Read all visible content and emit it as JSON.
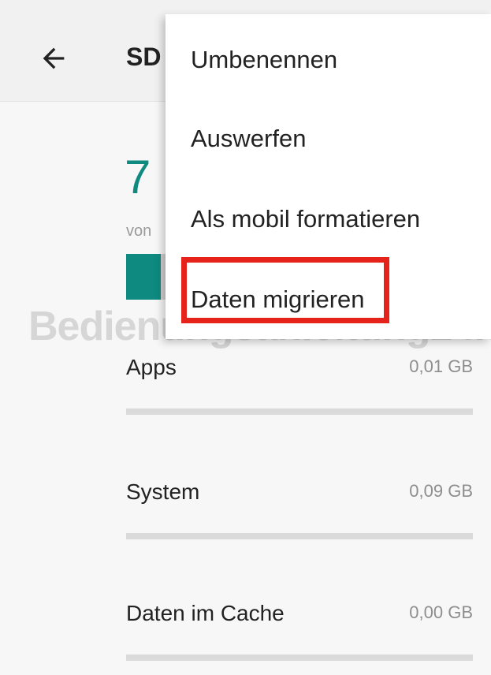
{
  "toolbar": {
    "title": "SD",
    "back_icon": "arrow-left-icon"
  },
  "summary": {
    "used_value": "7",
    "total_label": "von",
    "used_fraction": 0.1
  },
  "menu": {
    "items": [
      {
        "label": "Umbenennen"
      },
      {
        "label": "Auswerfen"
      },
      {
        "label": "Als mobil formatieren"
      },
      {
        "label": "Daten migrieren",
        "highlighted": true
      }
    ]
  },
  "watermark": "Bedienungsanleitung24.de",
  "storage_rows": [
    {
      "label": "Apps",
      "value": "0,01 GB"
    },
    {
      "label": "System",
      "value": "0,09 GB"
    },
    {
      "label": "Daten im Cache",
      "value": "0,00 GB"
    }
  ],
  "colors": {
    "accent": "#0e8a80",
    "highlight": "#e5231b"
  }
}
